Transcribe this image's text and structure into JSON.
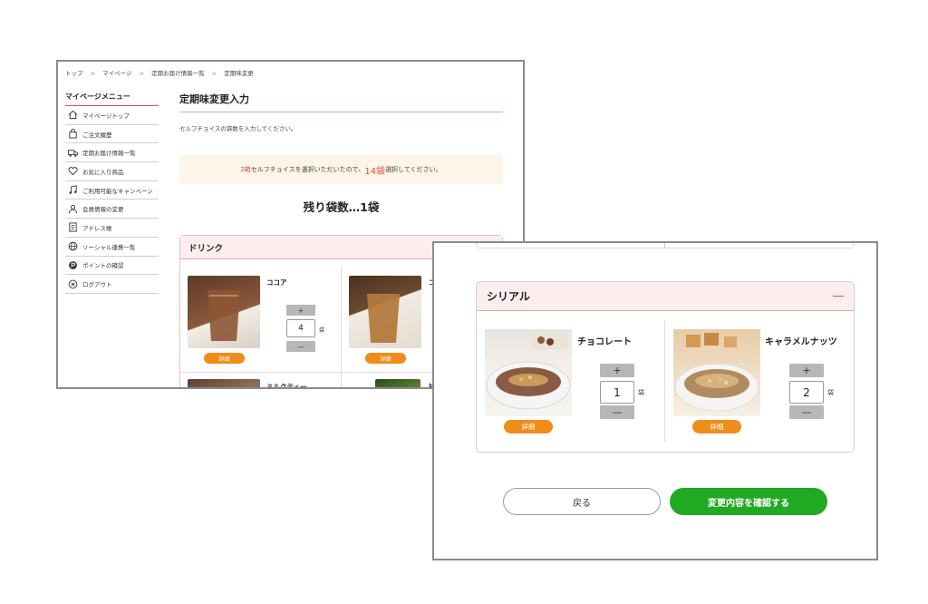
{
  "breadcrumb": [
    "トップ",
    ">",
    "マイページ",
    ">",
    "定期お届け情報一覧",
    ">",
    "定期味変更"
  ],
  "sidebar": {
    "title": "マイページメニュー",
    "items": [
      {
        "label": "マイページトップ",
        "icon": "home-icon"
      },
      {
        "label": "ご注文履歴",
        "icon": "shopping-bag-icon"
      },
      {
        "label": "定期お届け情報一覧",
        "icon": "truck-icon"
      },
      {
        "label": "お気に入り商品",
        "icon": "heart-icon"
      },
      {
        "label": "ご利用可能なキャンペーン",
        "icon": "music-note-icon"
      },
      {
        "label": "会員情報の変更",
        "icon": "person-icon"
      },
      {
        "label": "アドレス帳",
        "icon": "address-book-icon"
      },
      {
        "label": "ソーシャル連携一覧",
        "icon": "globe-icon"
      },
      {
        "label": "ポイントの確認",
        "icon": "points-icon"
      },
      {
        "label": "ログアウト",
        "icon": "logout-icon"
      }
    ]
  },
  "main": {
    "title": "定期味変更入力",
    "instruction": "セルフチョイスの袋数を入力してください。",
    "notice": {
      "box_count": "2箱",
      "middle": " セルフチョイスを選択いただいたので、",
      "bag_count": "14袋",
      "end": " 選択してください。"
    },
    "remaining": "残り袋数…1袋"
  },
  "drink_category": {
    "title": "ドリンク",
    "products": [
      {
        "name": "ココア",
        "qty": "4",
        "unit": "袋",
        "detail": "詳細",
        "plus": "+",
        "minus": "—"
      },
      {
        "name": "コ",
        "detail": "詳細"
      },
      {
        "name": "ミルクティー"
      },
      {
        "name": "抹"
      }
    ]
  },
  "cereal_category": {
    "title": "シリアル",
    "products": [
      {
        "name": "チョコレート",
        "qty": "1",
        "unit": "袋",
        "detail": "詳細",
        "plus": "+",
        "minus": "—"
      },
      {
        "name": "キャラメルナッツ",
        "qty": "2",
        "unit": "袋",
        "detail": "詳細",
        "plus": "+",
        "minus": "—"
      }
    ]
  },
  "actions": {
    "back": "戻る",
    "confirm": "変更内容を確認する"
  },
  "colors": {
    "accent_red": "#e24b4b",
    "detail_orange": "#f08c1a",
    "confirm_green": "#22a922",
    "category_header_pink": "#fdeeee",
    "notice_bg": "#fdf5e7"
  }
}
